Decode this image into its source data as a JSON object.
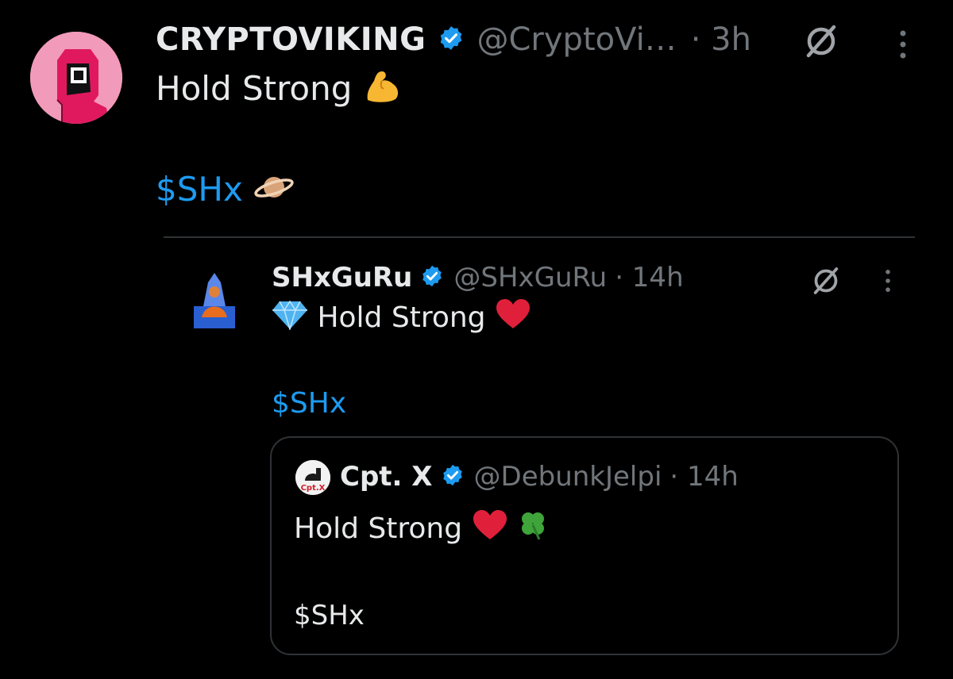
{
  "main_tweet": {
    "display_name": "CRYPTOVIKING",
    "handle": "@CryptoVi…",
    "time": "· 3h",
    "text": "Hold Strong",
    "text_emoji": "flexed-biceps",
    "cashtag": "$SHx",
    "cashtag_emoji": "ringed-planet"
  },
  "reply_tweet": {
    "display_name": "SHxGuRu",
    "handle": "@SHxGuRu",
    "time": "· 14h",
    "text": "Hold Strong",
    "text_emoji_before": "gem-stone",
    "text_emoji_after": "red-heart",
    "cashtag": "$SHx"
  },
  "quoted_tweet": {
    "display_name": "Cpt. X",
    "handle": "@DebunkJelpi",
    "time": "· 14h",
    "avatar_text": "Cpt.X",
    "text": "Hold Strong",
    "text_emojis": [
      "red-heart",
      "four-leaf-clover"
    ],
    "cashtag": "$SHx"
  },
  "icons": {
    "verified": "verified-badge-icon",
    "grok": "grok-icon",
    "more": "more-options-icon"
  },
  "colors": {
    "background": "#000000",
    "text_primary": "#e7e9ea",
    "text_secondary": "#71767b",
    "link": "#1d9bf0",
    "verified": "#1d9bf0",
    "border": "#2f3336",
    "avatar_main_bg": "#f29ab9"
  }
}
